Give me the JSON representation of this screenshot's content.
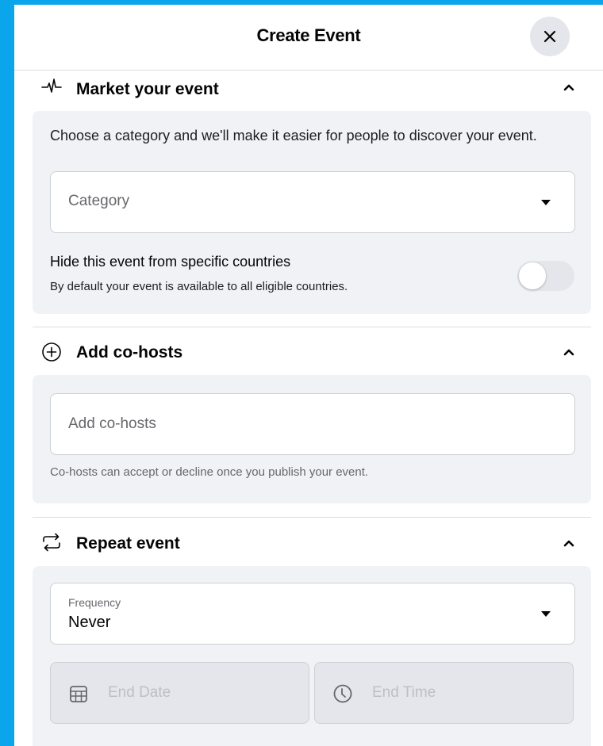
{
  "modal": {
    "title": "Create Event"
  },
  "market": {
    "title": "Market your event",
    "description": "Choose a category and we'll make it easier for people to discover your event.",
    "category_placeholder": "Category",
    "hide_title": "Hide this event from specific countries",
    "hide_subtitle": "By default your event is available to all eligible countries.",
    "hide_enabled": false
  },
  "cohosts": {
    "title": "Add co-hosts",
    "input_placeholder": "Add co-hosts",
    "help": "Co-hosts can accept or decline once you publish your event."
  },
  "repeat": {
    "title": "Repeat event",
    "frequency_label": "Frequency",
    "frequency_value": "Never",
    "end_date_placeholder": "End Date",
    "end_time_placeholder": "End Time"
  },
  "icons": {
    "close": "close-icon",
    "market": "activity-pulse-icon",
    "cohosts": "add-circle-icon",
    "repeat": "repeat-icon",
    "collapse": "chevron-up-icon",
    "dropdown": "caret-down-icon",
    "calendar": "calendar-icon",
    "clock": "clock-icon"
  },
  "colors": {
    "background": "#0ba5ec",
    "panel": "#f0f2f5",
    "disabled_field": "#e4e6eb",
    "secondary_text": "#65676b"
  }
}
